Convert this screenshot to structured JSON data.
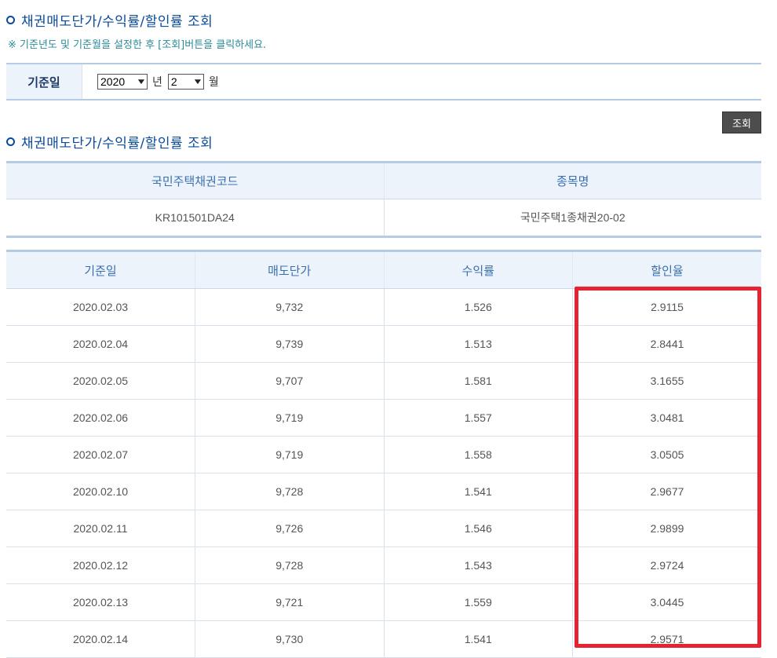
{
  "page": {
    "title": "채권매도단가/수익률/할인률 조회",
    "notice": "※ 기준년도 및 기준월을 설정한 후 [조회]버튼을 클릭하세요."
  },
  "filter": {
    "label": "기준일",
    "year_value": "2020",
    "year_unit": "년",
    "month_value": "2",
    "month_unit": "월",
    "query_button": "조회"
  },
  "results_title": "채권매도단가/수익률/할인률 조회",
  "bond": {
    "headers": [
      "국민주택채권코드",
      "종목명"
    ],
    "code": "KR101501DA24",
    "name": "국민주택1종채권20-02"
  },
  "rates": {
    "headers": [
      "기준일",
      "매도단가",
      "수익률",
      "할인율"
    ],
    "rows": [
      [
        "2020.02.03",
        "9,732",
        "1.526",
        "2.9115"
      ],
      [
        "2020.02.04",
        "9,739",
        "1.513",
        "2.8441"
      ],
      [
        "2020.02.05",
        "9,707",
        "1.581",
        "3.1655"
      ],
      [
        "2020.02.06",
        "9,719",
        "1.557",
        "3.0481"
      ],
      [
        "2020.02.07",
        "9,719",
        "1.558",
        "3.0505"
      ],
      [
        "2020.02.10",
        "9,728",
        "1.541",
        "2.9677"
      ],
      [
        "2020.02.11",
        "9,726",
        "1.546",
        "2.9899"
      ],
      [
        "2020.02.12",
        "9,728",
        "1.543",
        "2.9724"
      ],
      [
        "2020.02.13",
        "9,721",
        "1.559",
        "3.0445"
      ],
      [
        "2020.02.14",
        "9,730",
        "1.541",
        "2.9571"
      ]
    ]
  },
  "colors": {
    "title": "#0b4a9a",
    "header_bg": "#edf3fb",
    "highlight": "#e42333"
  }
}
